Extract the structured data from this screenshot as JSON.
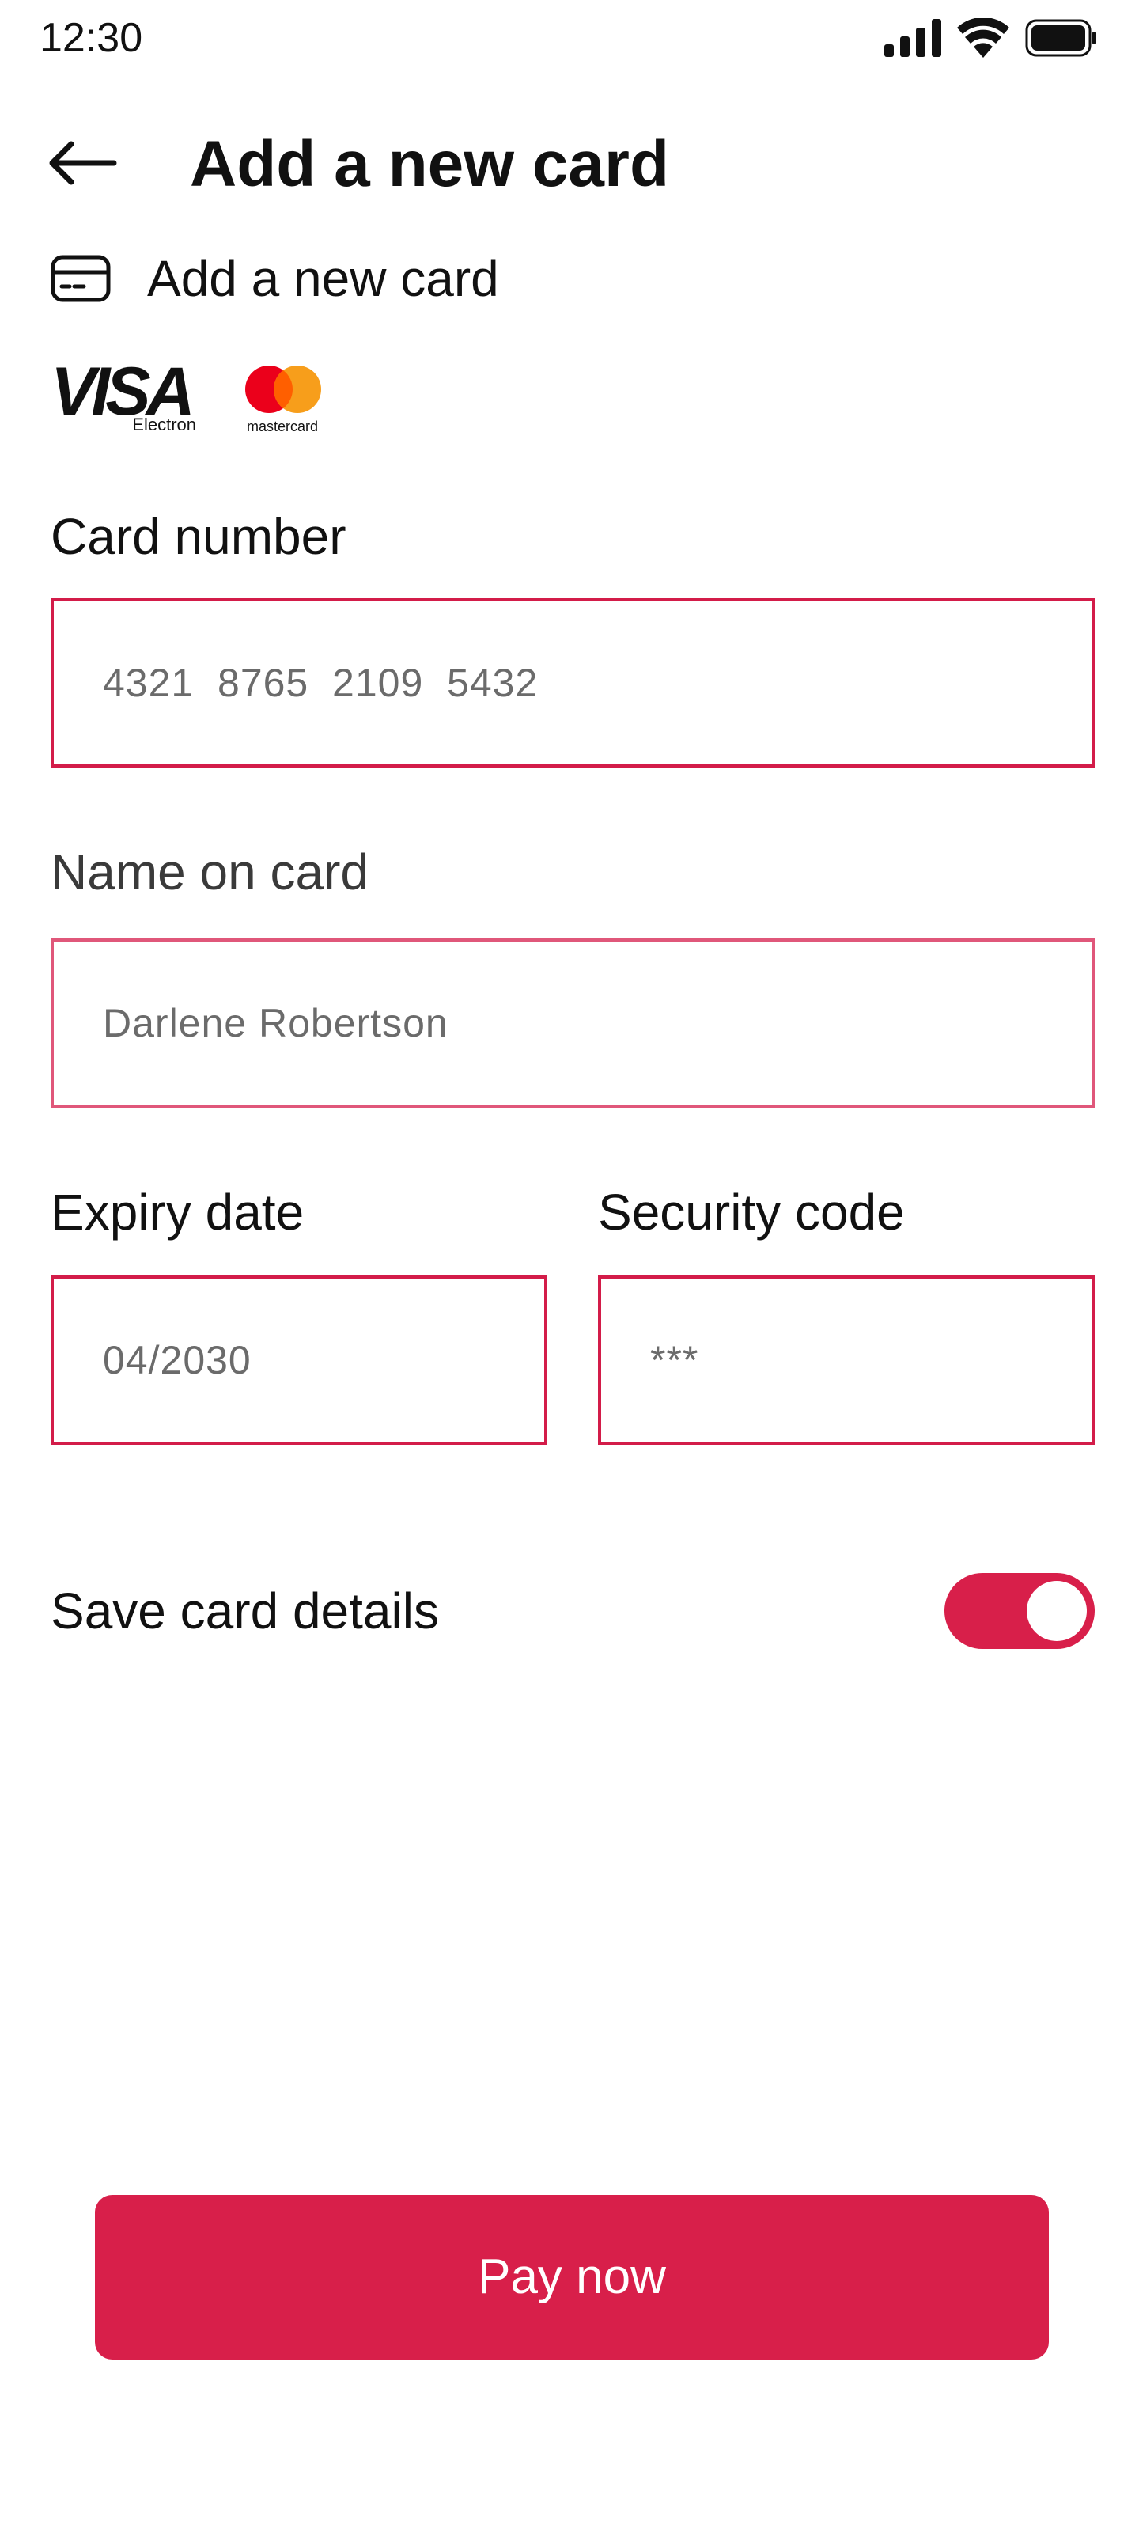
{
  "status_bar": {
    "time": "12:30",
    "icons": [
      "signal-icon",
      "wifi-icon",
      "battery-icon"
    ]
  },
  "header": {
    "back_icon": "arrow-left-icon",
    "title": "Add a new card"
  },
  "section": {
    "icon": "credit-card-icon",
    "title": "Add a new card"
  },
  "brands": {
    "visa": {
      "word": "VISA",
      "sub": "Electron"
    },
    "mastercard": {
      "word": "mastercard"
    }
  },
  "form": {
    "card_number": {
      "label": "Card number",
      "value": "4321  8765  2109  5432"
    },
    "name_on_card": {
      "label": "Name on card",
      "value": "Darlene Robertson"
    },
    "expiry_date": {
      "label": "Expiry date",
      "value": "04/2030"
    },
    "security_code": {
      "label": "Security code",
      "value": "***"
    }
  },
  "save_card": {
    "label": "Save card details",
    "enabled": true
  },
  "pay_button": {
    "label": "Pay now"
  },
  "colors": {
    "accent": "#d81f4a",
    "field_border": "#d31c49",
    "mastercard_red": "#eb001b",
    "mastercard_orange": "#f79e1b"
  }
}
